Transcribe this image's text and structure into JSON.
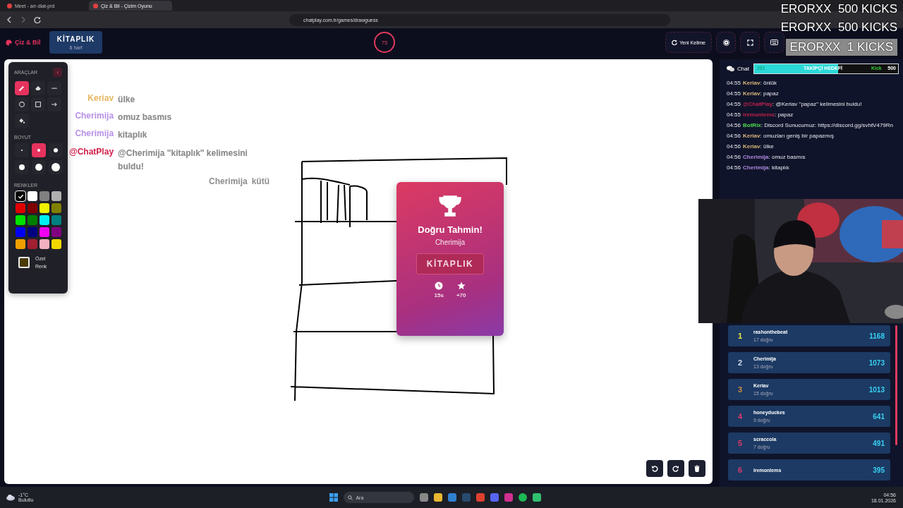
{
  "browser": {
    "tabs": [
      {
        "title": "Meet - arr-diat-prd",
        "selected": false
      },
      {
        "title": "Çiz & Bil - Çizim Oyunu",
        "selected": true
      }
    ],
    "url": "chatplay.com.tr/games/drawguess"
  },
  "stream_alerts": [
    {
      "text": "ERORXX  500 KICKS",
      "boxed": false
    },
    {
      "text": "ERORXX  500 KICKS",
      "boxed": false
    },
    {
      "text": "ERORXX  1 KICKS",
      "boxed": true
    }
  ],
  "header": {
    "logo": "Çiz & Bil",
    "word": "KİTAPLIK",
    "word_hint": "8 harf",
    "timer": "75",
    "buttons": [
      {
        "kind": "refresh",
        "label": "Yeni Kelime"
      },
      {
        "kind": "settings"
      },
      {
        "kind": "fullscreen"
      },
      {
        "kind": "keyboard"
      }
    ]
  },
  "tools": {
    "title": "ARAÇLAR",
    "items": [
      {
        "kind": "pen",
        "selected": true
      },
      {
        "kind": "eraser",
        "selected": false
      },
      {
        "kind": "line",
        "selected": false
      },
      {
        "kind": "circle",
        "selected": false
      },
      {
        "kind": "rect",
        "selected": false
      },
      {
        "kind": "arrow",
        "selected": false
      },
      {
        "kind": "fill",
        "selected": false
      }
    ],
    "size_title": "BOYUT",
    "sizes": [
      {
        "selected": false
      },
      {
        "selected": true
      },
      {
        "selected": false
      },
      {
        "selected": false
      },
      {
        "selected": false
      },
      {
        "selected": false
      }
    ],
    "colors_title": "RENKLER",
    "colors": [
      {
        "color": "#000000",
        "selected": true
      },
      {
        "color": "#ffffff",
        "selected": false
      },
      {
        "color": "#808080",
        "selected": false
      },
      {
        "color": "#b0b0b0",
        "selected": false
      },
      {
        "color": "#e00000",
        "selected": false
      },
      {
        "color": "#800000",
        "selected": false
      },
      {
        "color": "#f0f000",
        "selected": false
      },
      {
        "color": "#808000",
        "selected": false
      },
      {
        "color": "#00e000",
        "selected": false
      },
      {
        "color": "#008000",
        "selected": false
      },
      {
        "color": "#00f0f0",
        "selected": false
      },
      {
        "color": "#008080",
        "selected": false
      },
      {
        "color": "#0000f0",
        "selected": false
      },
      {
        "color": "#000080",
        "selected": false
      },
      {
        "color": "#f000f0",
        "selected": false
      },
      {
        "color": "#800080",
        "selected": false
      },
      {
        "color": "#f0a000",
        "selected": false
      },
      {
        "color": "#a02030",
        "selected": false
      },
      {
        "color": "#f0b0c0",
        "selected": false
      },
      {
        "color": "#f0d800",
        "selected": false
      }
    ],
    "custom_label": "Özel Renk"
  },
  "guesses": [
    {
      "user": "Keriav",
      "text": "ülke",
      "color": "#e8b860"
    },
    {
      "user": "Cherimija",
      "text": "omuz basmıs",
      "color": "#b890e8"
    },
    {
      "user": "Cherimija",
      "text": "kitaplık",
      "color": "#b890e8"
    },
    {
      "user": "@ChatPlay",
      "text": "@Cherimija \"kitaplık\" kelimesini buldu!",
      "color": "#d0204a"
    }
  ],
  "faded_guess": {
    "user": "Cherimija",
    "text": "kütü"
  },
  "result_card": {
    "title": "Doğru Tahmin!",
    "winner": "Cherimija",
    "word": "KİTAPLIK",
    "time": "15s",
    "points": "+70"
  },
  "chat": {
    "tab": "Chat",
    "goal": {
      "current": "291",
      "label": "TAKİPÇİ HEDEFİ",
      "platform": "Kick",
      "target": "500",
      "level": 0.582
    },
    "messages": [
      {
        "time": "04:55",
        "user": "Keriav",
        "color": "#d9b77a",
        "text": ": önlük"
      },
      {
        "time": "04:55",
        "user": "Keriav",
        "color": "#d9b77a",
        "text": ": papaz"
      },
      {
        "time": "04:55",
        "user": "@ChatPlay",
        "color": "#c0204a",
        "text": ": @Keriav \"papaz\" kelimesini buldu!"
      },
      {
        "time": "04:55",
        "user": "iremonlems",
        "color": "#c0204a",
        "text": ": papaz"
      },
      {
        "time": "04:56",
        "user": "BotRix",
        "color": "#4ddb4d",
        "text": ": Discord Sunucumuz: https://discord.gg/svhtV479Rn"
      },
      {
        "time": "04:56",
        "user": "Keriav",
        "color": "#d9b77a",
        "text": ": omuzları geniş bir papazmış"
      },
      {
        "time": "04:56",
        "user": "Keriav",
        "color": "#d9b77a",
        "text": ": ülke"
      },
      {
        "time": "04:56",
        "user": "Cherimija",
        "color": "#b088e0",
        "text": ": omuz basmıs"
      },
      {
        "time": "04:56",
        "user": "Cherimija",
        "color": "#b088e0",
        "text": ": kitaplık"
      }
    ]
  },
  "leaderboard": [
    {
      "rank": "1",
      "name": "rashonthebeat",
      "correct": "17 doğru",
      "score": "1168",
      "color": "#e8e040"
    },
    {
      "rank": "2",
      "name": "Cherimija",
      "correct": "13 doğru",
      "score": "1073",
      "color": "#d0d8e8"
    },
    {
      "rank": "3",
      "name": "Keriav",
      "correct": "15 doğru",
      "score": "1013",
      "color": "#d08a40"
    },
    {
      "rank": "4",
      "name": "honeyduckes",
      "correct": "9 doğru",
      "score": "641",
      "color": "#e0386a"
    },
    {
      "rank": "5",
      "name": "scraccola",
      "correct": "7 doğru",
      "score": "491",
      "color": "#e0386a"
    },
    {
      "rank": "6",
      "name": "iremonlems",
      "score": "395",
      "color": "#e0386a"
    }
  ],
  "taskbar": {
    "temperature": "-1°C",
    "weather": "Bulutlu",
    "search": "Ara",
    "time": "04:56",
    "date": "18.01.2026"
  }
}
